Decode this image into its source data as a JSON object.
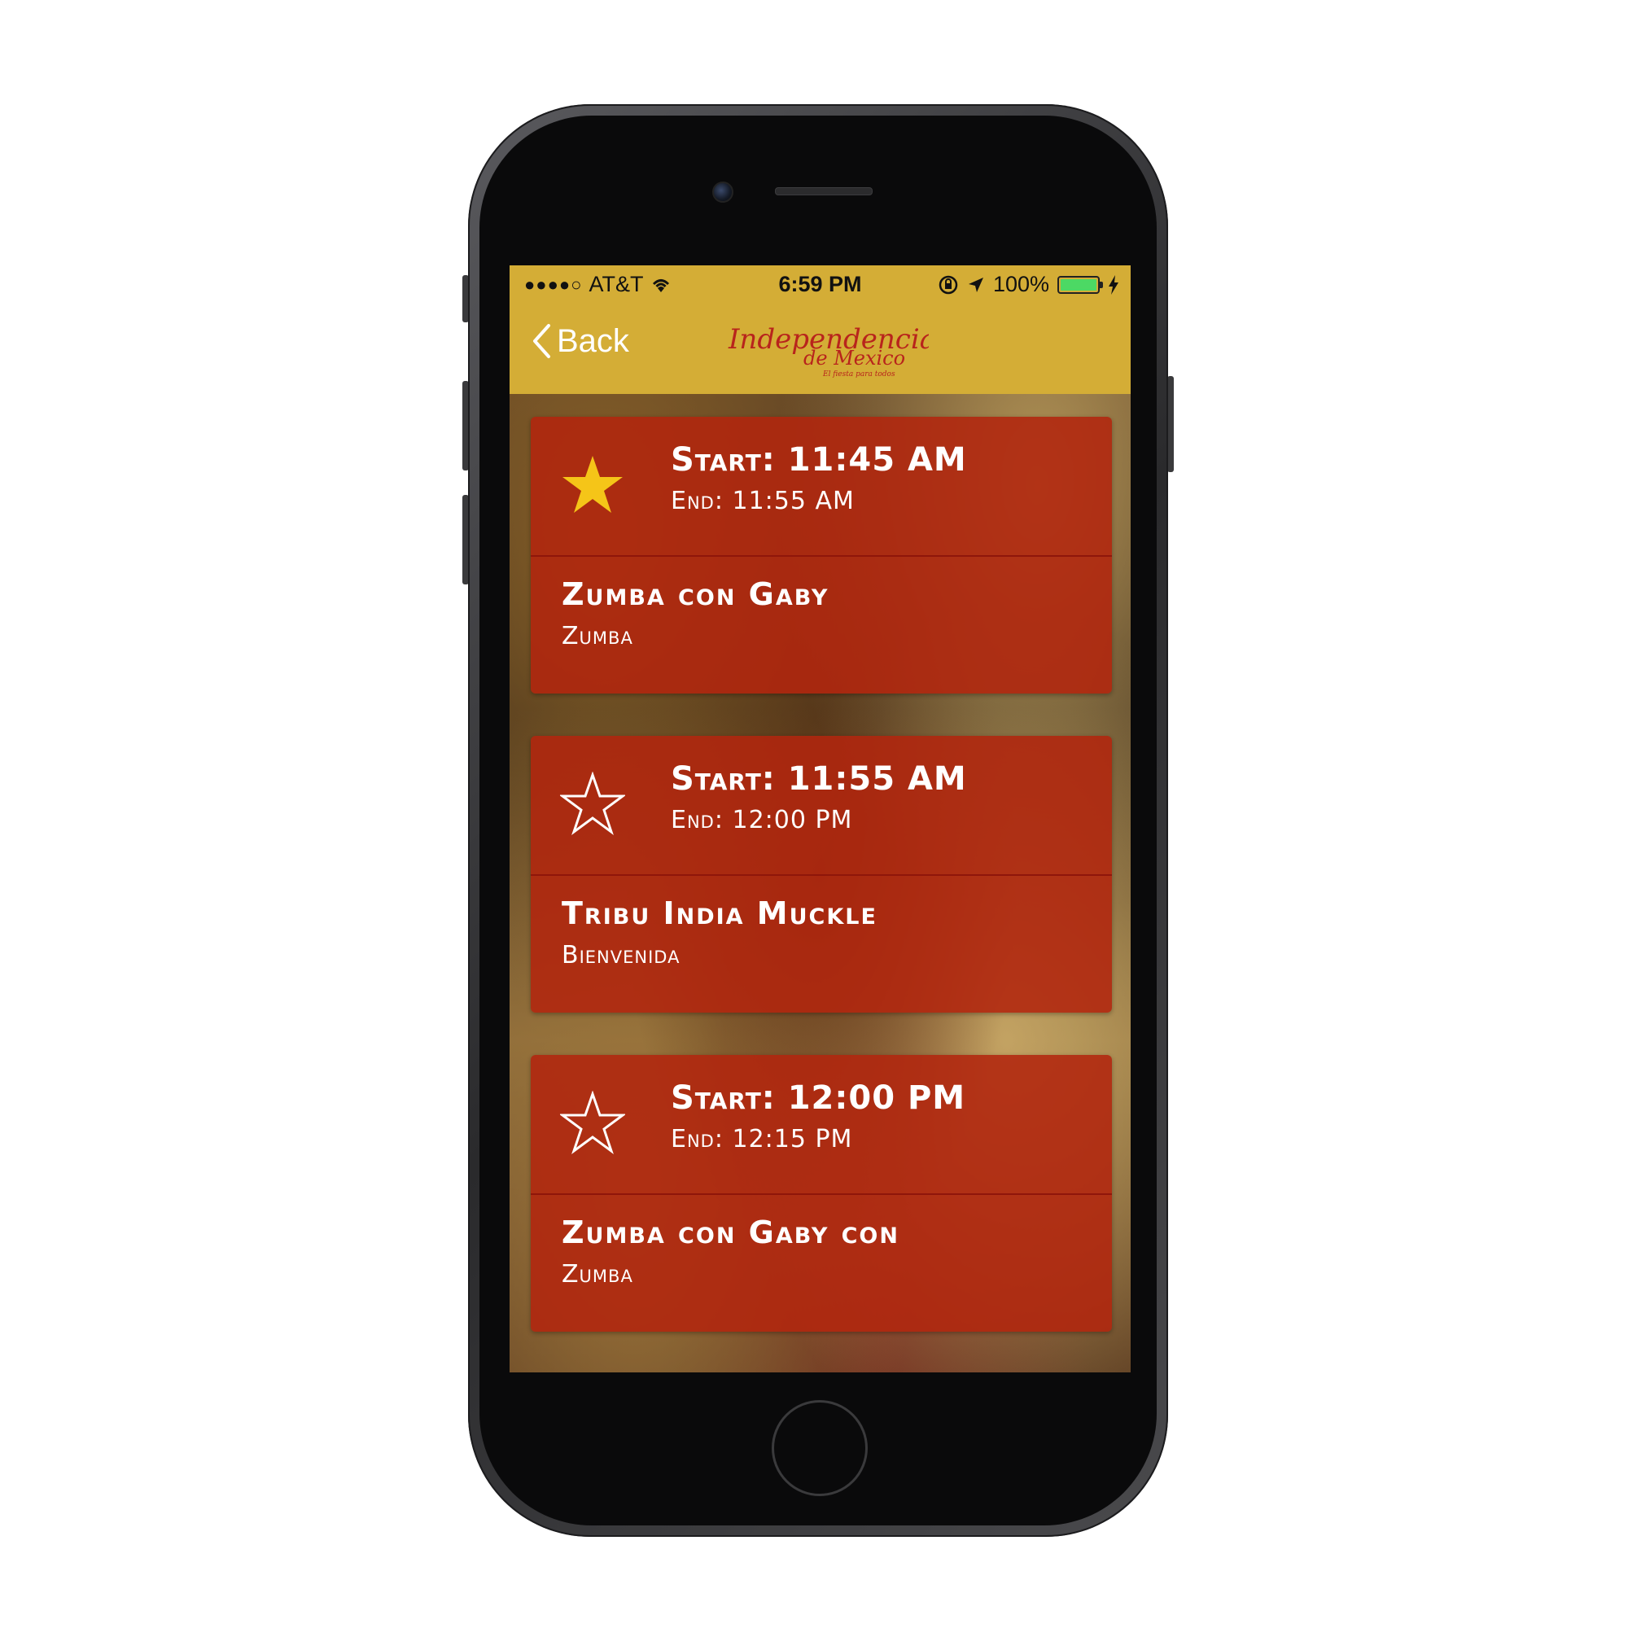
{
  "status_bar": {
    "signal": "●●●●○",
    "carrier": "AT&T",
    "time": "6:59 PM",
    "battery_percent": "100%",
    "battery_level": 1.0,
    "battery_color": "#4cd964"
  },
  "nav": {
    "back_label": "Back",
    "logo_line1": "Independencia",
    "logo_line2": "de Mexico",
    "logo_tagline": "El fiesta para todos"
  },
  "colors": {
    "nav_background": "#d4ad36",
    "card_background": "#b2260e",
    "star_favorited": "#f5c518",
    "text": "#ffffff"
  },
  "events": [
    {
      "start": "Start: 11:45 AM",
      "end": "End: 11:55 AM",
      "title": "Zumba con Gaby",
      "category": "Zumba",
      "favorited": true,
      "star_icon": "star-filled-icon"
    },
    {
      "start": "Start: 11:55 AM",
      "end": "End: 12:00 PM",
      "title": "Tribu India Muckle",
      "category": "Bienvenida",
      "favorited": false,
      "star_icon": "star-outline-icon"
    },
    {
      "start": "Start: 12:00 PM",
      "end": "End: 12:15 PM",
      "title": "Zumba con Gaby con",
      "category": "Zumba",
      "favorited": false,
      "star_icon": "star-outline-icon"
    }
  ]
}
